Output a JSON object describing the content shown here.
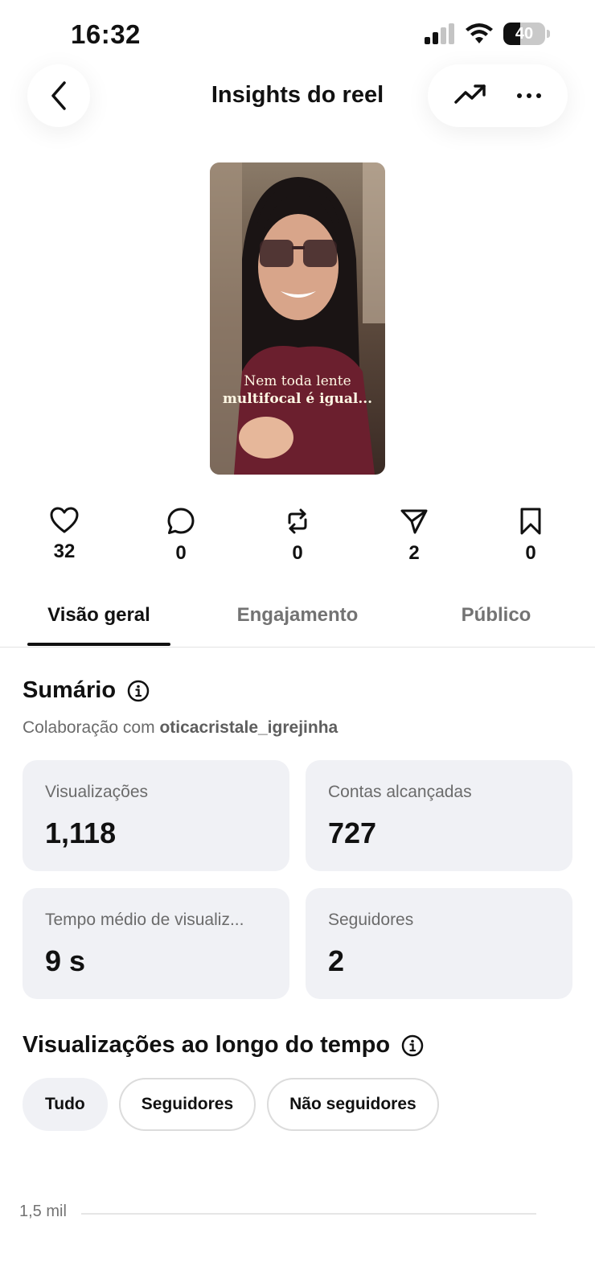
{
  "status_bar": {
    "time": "16:32",
    "battery_level": "40",
    "battery_fraction": 0.4
  },
  "header": {
    "title": "Insights do reel"
  },
  "reel": {
    "caption_line1": "Nem toda lente",
    "caption_line2": "multifocal é igual..."
  },
  "metrics": [
    {
      "icon": "heart-icon",
      "value": "32"
    },
    {
      "icon": "comment-icon",
      "value": "0"
    },
    {
      "icon": "repost-icon",
      "value": "0"
    },
    {
      "icon": "send-icon",
      "value": "2"
    },
    {
      "icon": "bookmark-icon",
      "value": "0"
    }
  ],
  "tabs": [
    {
      "label": "Visão geral",
      "active": true
    },
    {
      "label": "Engajamento",
      "active": false
    },
    {
      "label": "Público",
      "active": false
    }
  ],
  "summary": {
    "title": "Sumário",
    "collab_prefix": "Colaboração com",
    "collab_user": "oticacristale_igrejinha",
    "cards": [
      {
        "label": "Visualizações",
        "value": "1,118"
      },
      {
        "label": "Contas alcançadas",
        "value": "727"
      },
      {
        "label": "Tempo médio de visualiz...",
        "value": "9 s"
      },
      {
        "label": "Seguidores",
        "value": "2"
      }
    ]
  },
  "views_over_time": {
    "title": "Visualizações ao longo do tempo",
    "filters": [
      {
        "label": "Tudo",
        "selected": true
      },
      {
        "label": "Seguidores",
        "selected": false
      },
      {
        "label": "Não seguidores",
        "selected": false
      }
    ],
    "y_tick": "1,5 mil"
  },
  "colors": {
    "card_bg": "#f0f1f5",
    "text_primary": "#111111",
    "text_secondary": "#737373"
  }
}
